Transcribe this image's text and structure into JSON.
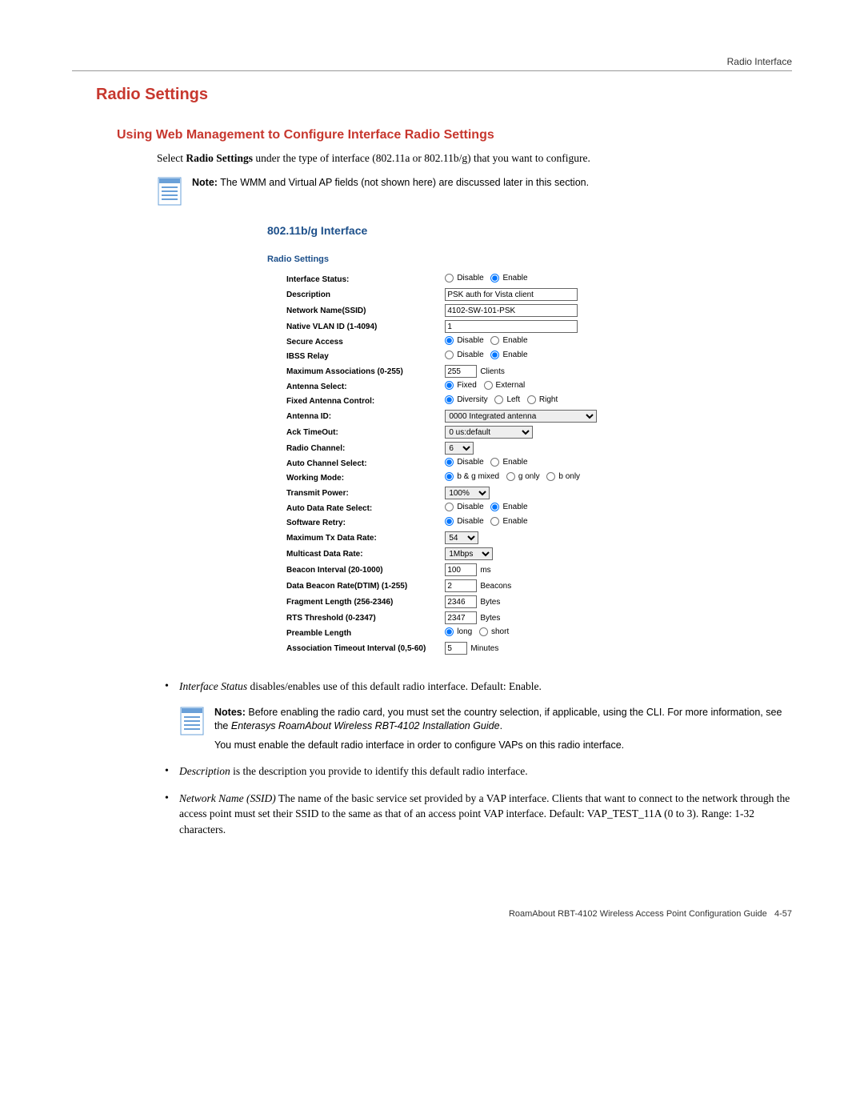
{
  "header": {
    "right": "Radio Interface"
  },
  "h1": "Radio Settings",
  "h2": "Using Web Management to Configure Interface Radio Settings",
  "intro": {
    "pre": "Select ",
    "bold": "Radio Settings",
    "post": " under the type of interface (802.11a or 802.11b/g) that you want to configure."
  },
  "note1": {
    "label": "Note:",
    "text": " The WMM and Virtual AP fields (not shown here) are discussed later in this section."
  },
  "panel": {
    "title": "802.11b/g Interface",
    "section": "Radio Settings",
    "rows": {
      "iface_status": {
        "label": "Interface Status:",
        "options": [
          "Disable",
          "Enable"
        ],
        "selected": "Enable"
      },
      "description": {
        "label": "Description",
        "value": "PSK auth for Vista client"
      },
      "ssid": {
        "label": "Network Name(SSID)",
        "value": "4102-SW-101-PSK"
      },
      "vlan": {
        "label": "Native VLAN ID (1-4094)",
        "value": "1"
      },
      "secure": {
        "label": "Secure Access",
        "options": [
          "Disable",
          "Enable"
        ],
        "selected": "Disable"
      },
      "ibss": {
        "label": "IBSS Relay",
        "options": [
          "Disable",
          "Enable"
        ],
        "selected": "Enable"
      },
      "maxassoc": {
        "label": "Maximum Associations (0-255)",
        "value": "255",
        "unit": "Clients"
      },
      "antsel": {
        "label": "Antenna Select:",
        "options": [
          "Fixed",
          "External"
        ],
        "selected": "Fixed"
      },
      "fixant": {
        "label": "Fixed Antenna Control:",
        "options": [
          "Diversity",
          "Left",
          "Right"
        ],
        "selected": "Diversity"
      },
      "antid": {
        "label": "Antenna ID:",
        "value": "0000 Integrated antenna"
      },
      "ack": {
        "label": "Ack TimeOut:",
        "value": "0 us:default"
      },
      "channel": {
        "label": "Radio Channel:",
        "value": "6"
      },
      "autoch": {
        "label": "Auto Channel Select:",
        "options": [
          "Disable",
          "Enable"
        ],
        "selected": "Disable"
      },
      "wmode": {
        "label": "Working Mode:",
        "options": [
          "b & g mixed",
          "g only",
          "b only"
        ],
        "selected": "b & g mixed"
      },
      "txpower": {
        "label": "Transmit Power:",
        "value": "100%"
      },
      "autorate": {
        "label": "Auto Data Rate Select:",
        "options": [
          "Disable",
          "Enable"
        ],
        "selected": "Enable"
      },
      "swretry": {
        "label": "Software Retry:",
        "options": [
          "Disable",
          "Enable"
        ],
        "selected": "Disable"
      },
      "maxtx": {
        "label": "Maximum Tx Data Rate:",
        "value": "54"
      },
      "mcast": {
        "label": "Multicast Data Rate:",
        "value": "1Mbps"
      },
      "beacon": {
        "label": "Beacon Interval (20-1000)",
        "value": "100",
        "unit": "ms"
      },
      "dtim": {
        "label": "Data Beacon Rate(DTIM) (1-255)",
        "value": "2",
        "unit": "Beacons"
      },
      "frag": {
        "label": "Fragment Length (256-2346)",
        "value": "2346",
        "unit": "Bytes"
      },
      "rts": {
        "label": "RTS Threshold (0-2347)",
        "value": "2347",
        "unit": "Bytes"
      },
      "preamble": {
        "label": "Preamble Length",
        "options": [
          "long",
          "short"
        ],
        "selected": "long"
      },
      "assoc_to": {
        "label": "Association Timeout Interval (0,5-60)",
        "value": "5",
        "unit": "Minutes"
      }
    }
  },
  "bullets": {
    "b1": {
      "term": "Interface Status",
      "text": " disables/enables use of this default radio interface. Default: Enable."
    },
    "note": {
      "label": "Notes:",
      "line1": " Before enabling the radio card, you must set the country selection, if applicable, using the CLI. For more information, see the ",
      "italic": "Enterasys RoamAbout Wireless RBT-4102 Installation Guide",
      "end1": ".",
      "line2": "You must enable the default radio interface in order to configure VAPs on this radio interface."
    },
    "b2": {
      "term": "Description",
      "text": " is the description you provide to identify this default radio interface."
    },
    "b3": {
      "term": "Network Name (SSID)",
      "text": " The name of the basic service set provided by a VAP interface. Clients that want to connect to the network through the access point must set their SSID to the same as that of an access point VAP interface. Default: VAP_TEST_11A (0 to 3). Range: 1-32 characters."
    }
  },
  "footer": {
    "text": "RoamAbout RBT-4102 Wireless Access Point Configuration Guide",
    "page": "4-57"
  }
}
